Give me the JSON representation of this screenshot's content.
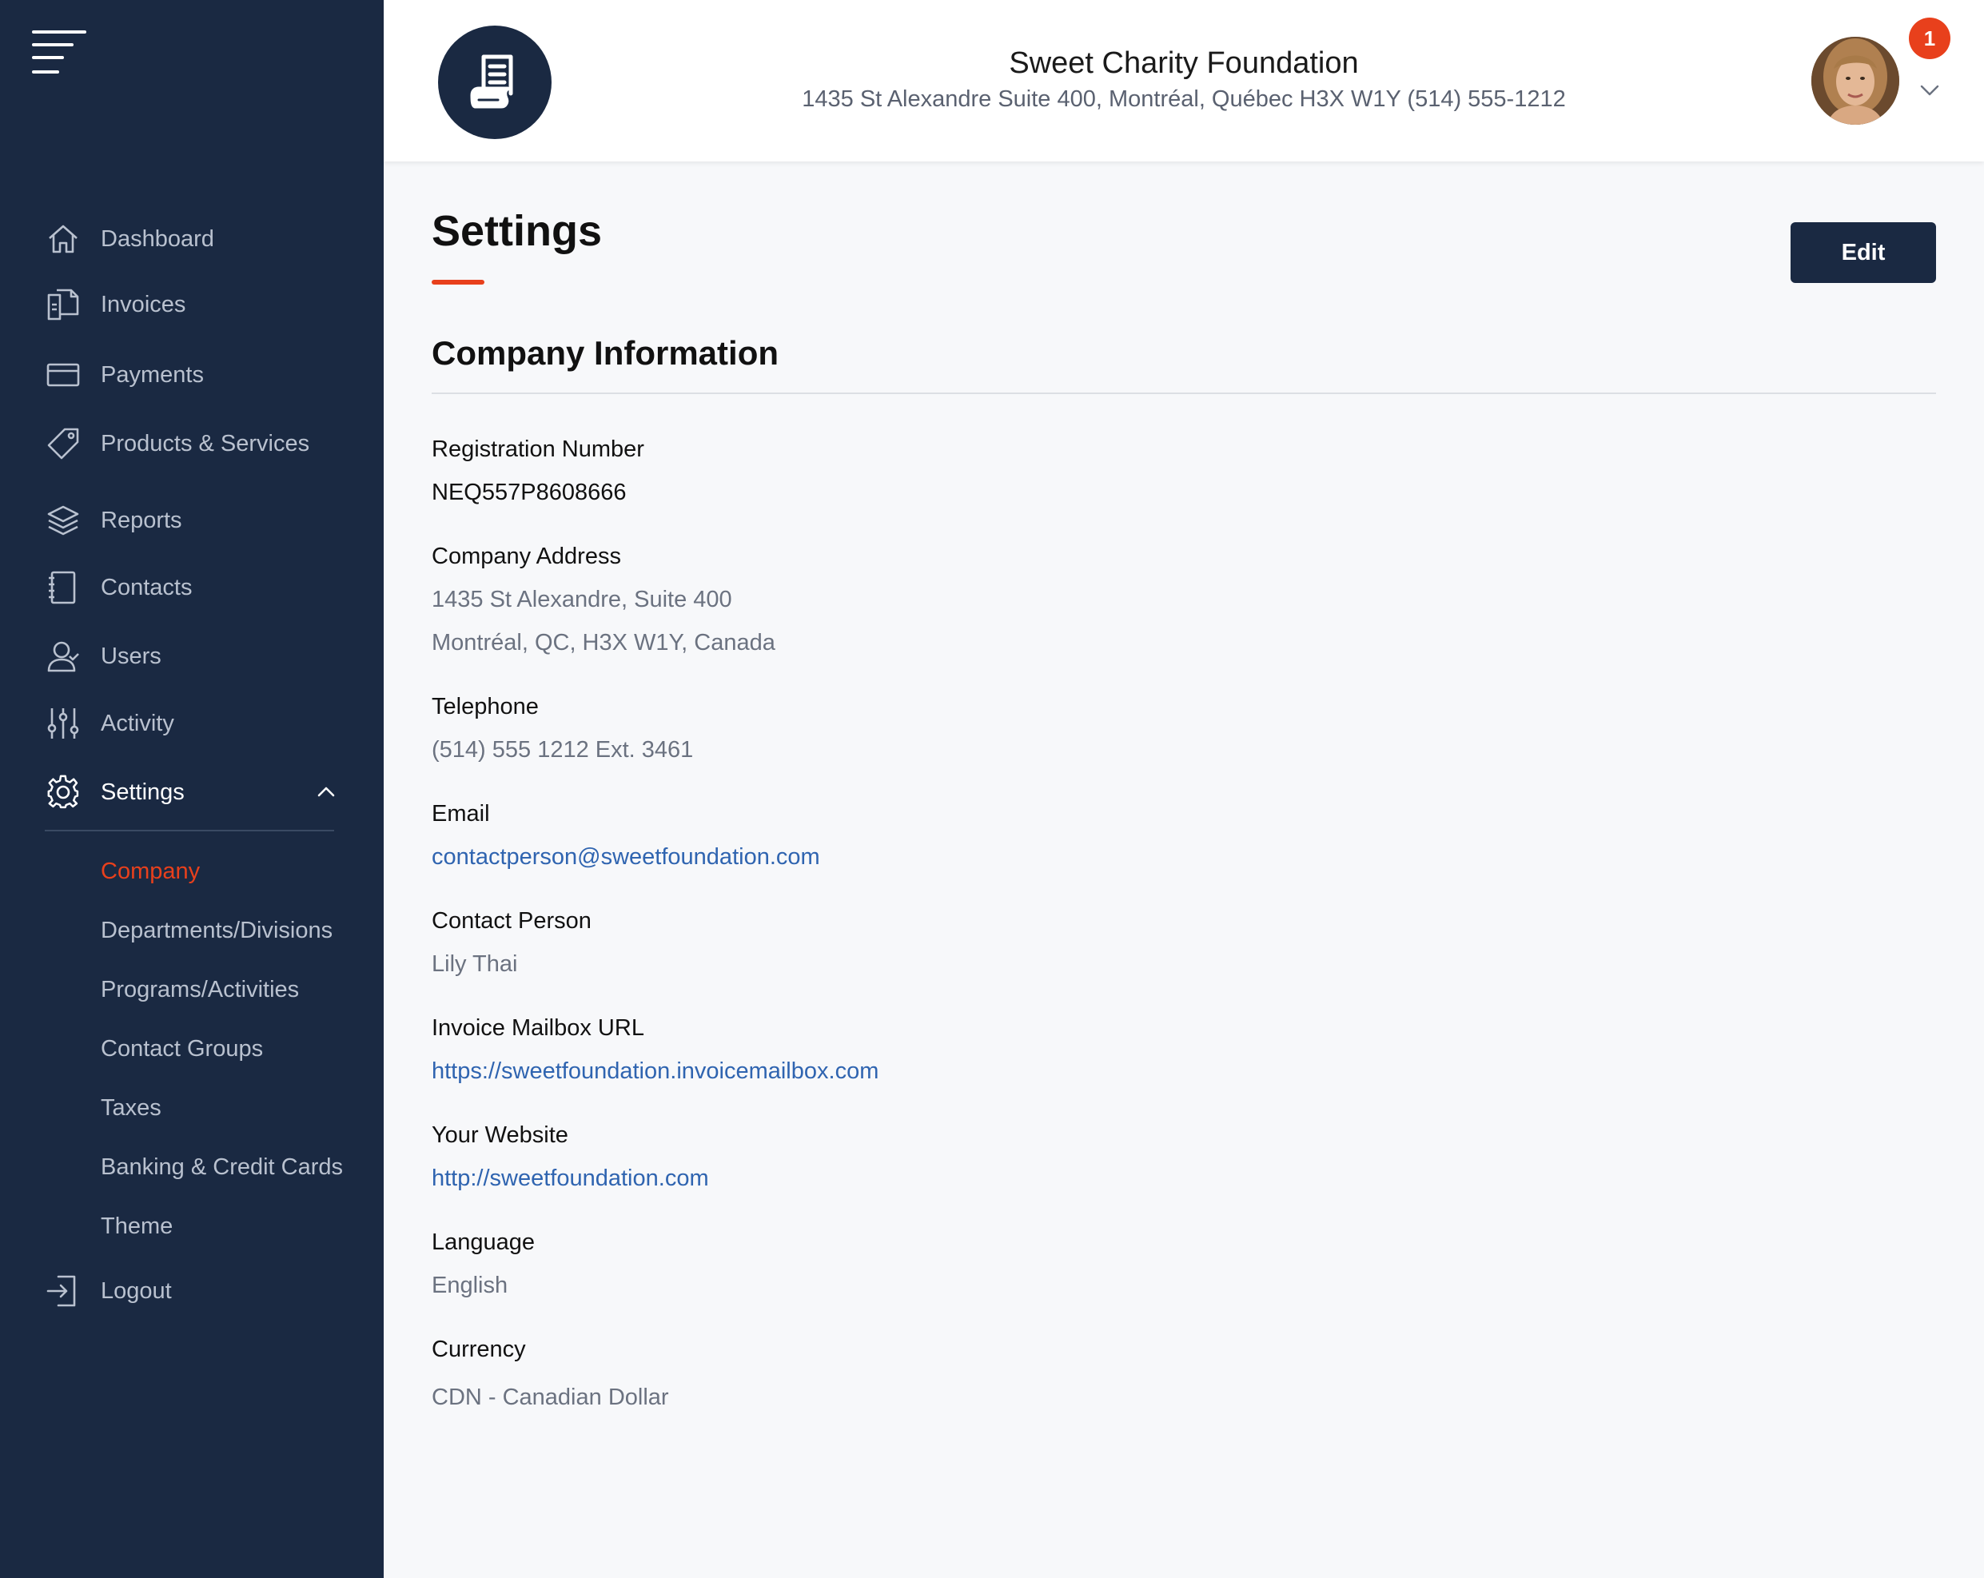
{
  "sidebar": {
    "menu_icon": "hamburger-menu-icon",
    "items": [
      {
        "label": "Dashboard",
        "icon": "home-icon"
      },
      {
        "label": "Invoices",
        "icon": "documents-icon"
      },
      {
        "label": "Payments",
        "icon": "credit-card-icon"
      },
      {
        "label": "Products & Services",
        "icon": "tag-icon"
      },
      {
        "label": "Reports",
        "icon": "layers-icon"
      },
      {
        "label": "Contacts",
        "icon": "address-book-icon"
      },
      {
        "label": "Users",
        "icon": "user-icon"
      },
      {
        "label": "Activity",
        "icon": "sliders-icon"
      },
      {
        "label": "Settings",
        "icon": "gear-icon",
        "expanded": true
      },
      {
        "label": "Logout",
        "icon": "logout-icon"
      }
    ],
    "settings_sub": [
      {
        "label": "Company",
        "active": true
      },
      {
        "label": "Departments/Divisions"
      },
      {
        "label": "Programs/Activities"
      },
      {
        "label": "Contact Groups"
      },
      {
        "label": "Taxes"
      },
      {
        "label": "Banking & Credit Cards"
      },
      {
        "label": "Theme"
      }
    ]
  },
  "header": {
    "org_name": "Sweet Charity Foundation",
    "org_address": "1435 St Alexandre Suite 400, Montréal, Québec H3X W1Y (514) 555-1212",
    "logo_icon": "receipt-icon",
    "notification_count": "1"
  },
  "page": {
    "title": "Settings",
    "edit_label": "Edit",
    "section_title": "Company Information"
  },
  "fields": {
    "registration": {
      "label": "Registration Number",
      "value": "NEQ557P8608666"
    },
    "address": {
      "label": "Company Address",
      "line1": "1435 St Alexandre, Suite 400",
      "line2": "Montréal, QC, H3X W1Y, Canada"
    },
    "telephone": {
      "label": "Telephone",
      "value": "(514) 555 1212 Ext. 3461"
    },
    "email": {
      "label": "Email",
      "value": "contactperson@sweetfoundation.com"
    },
    "contact_person": {
      "label": "Contact Person",
      "value": "Lily Thai"
    },
    "mailbox_url": {
      "label": "Invoice Mailbox URL",
      "value": "https://sweetfoundation.invoicemailbox.com"
    },
    "website": {
      "label": "Your Website",
      "value": "http://sweetfoundation.com"
    },
    "language": {
      "label": "Language",
      "value": "English"
    },
    "currency": {
      "label": "Currency",
      "value": "CDN - Canadian Dollar"
    }
  },
  "colors": {
    "sidebar_bg": "#1a2942",
    "accent": "#e8401c",
    "link": "#2f64b0",
    "content_bg": "#f7f8fa"
  }
}
